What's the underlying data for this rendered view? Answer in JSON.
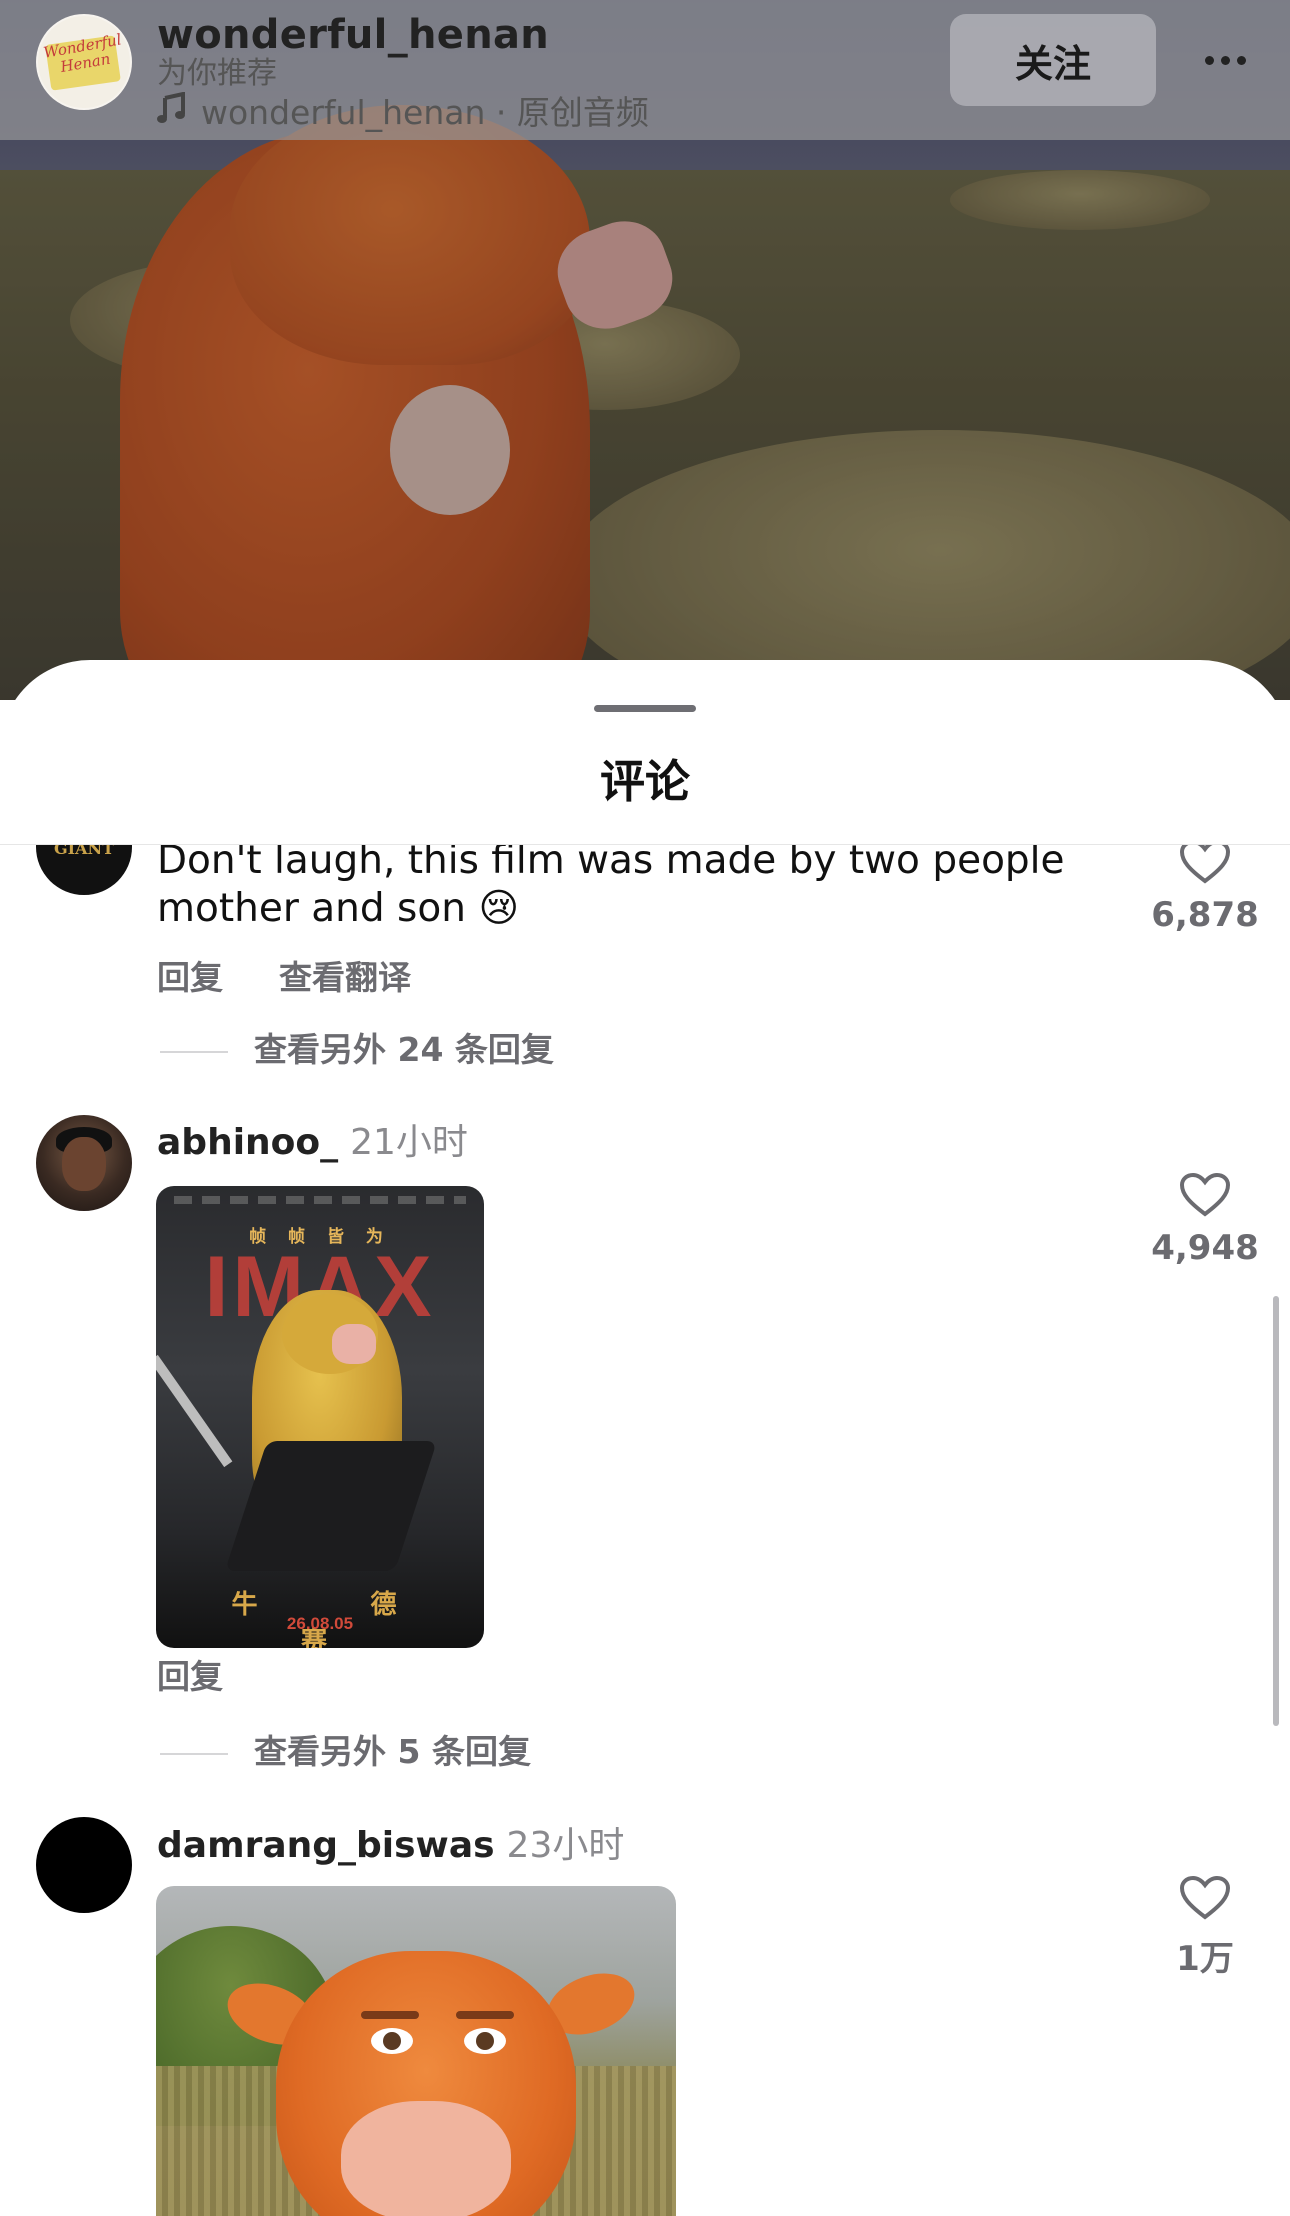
{
  "header": {
    "username": "wonderful_henan",
    "subtitle": "为你推荐",
    "music": "wonderful_henan · 原创音频",
    "follow_label": "关注",
    "avatar_text": "Wonderful Henan",
    "more_icon": "more-horizontal-icon"
  },
  "sheet": {
    "title": "评论"
  },
  "comments": [
    {
      "avatar_text": "GIANT",
      "text_line1": "Don't laugh, this film was made by two people",
      "text_line2": "mother and son 😢",
      "reply_label": "回复",
      "translate_label": "查看翻译",
      "more_replies": "查看另外 24 条回复",
      "likes": "6,878"
    },
    {
      "username": "abhinoo_",
      "time": "21小时",
      "reply_label": "回复",
      "more_replies": "查看另外 5 条回复",
      "likes": "4,948",
      "poster": {
        "top_text": "帧 帧 皆 为",
        "imax": "IMAX",
        "title": "牛 德 赛",
        "date": "26.08.05"
      }
    },
    {
      "username": "damrang_biswas",
      "time": "23小时",
      "likes": "1万"
    }
  ],
  "colors": {
    "accent_text": "#111111",
    "secondary_text": "#6b6b70",
    "sheet_bg": "#ffffff"
  }
}
